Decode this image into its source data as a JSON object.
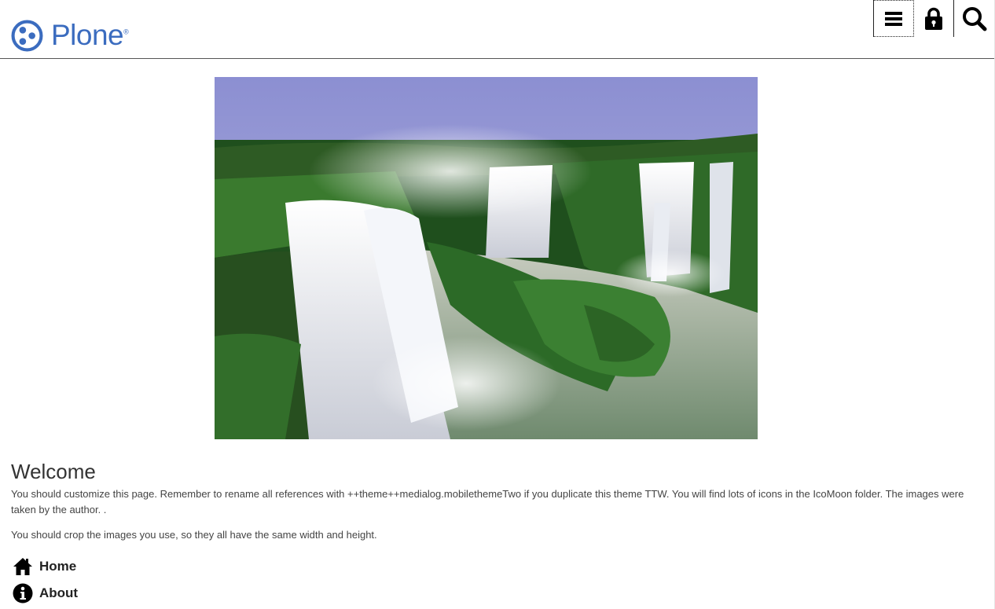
{
  "header": {
    "logo_text": "Plone",
    "logo_mark": "®",
    "toolbar": [
      {
        "name": "menu",
        "icon": "hamburger-menu-icon"
      },
      {
        "name": "login",
        "icon": "lock-icon"
      },
      {
        "name": "search",
        "icon": "search-icon"
      }
    ],
    "brand_color": "#3b6cbf"
  },
  "hero_image": {
    "subject": "waterfall-photo"
  },
  "main": {
    "title": "Welcome",
    "paragraph1": "You should customize this page. Remember to rename all references with ++theme++medialog.mobilethemeTwo if you duplicate this theme TTW. You will find lots of icons in the IcoMoon folder. The images were taken by the author. .",
    "paragraph2": "You should crop the images you use, so they all have the same width and height."
  },
  "nav": {
    "items": [
      {
        "label": "Home",
        "icon": "home-icon"
      },
      {
        "label": "About",
        "icon": "info-icon"
      }
    ]
  }
}
